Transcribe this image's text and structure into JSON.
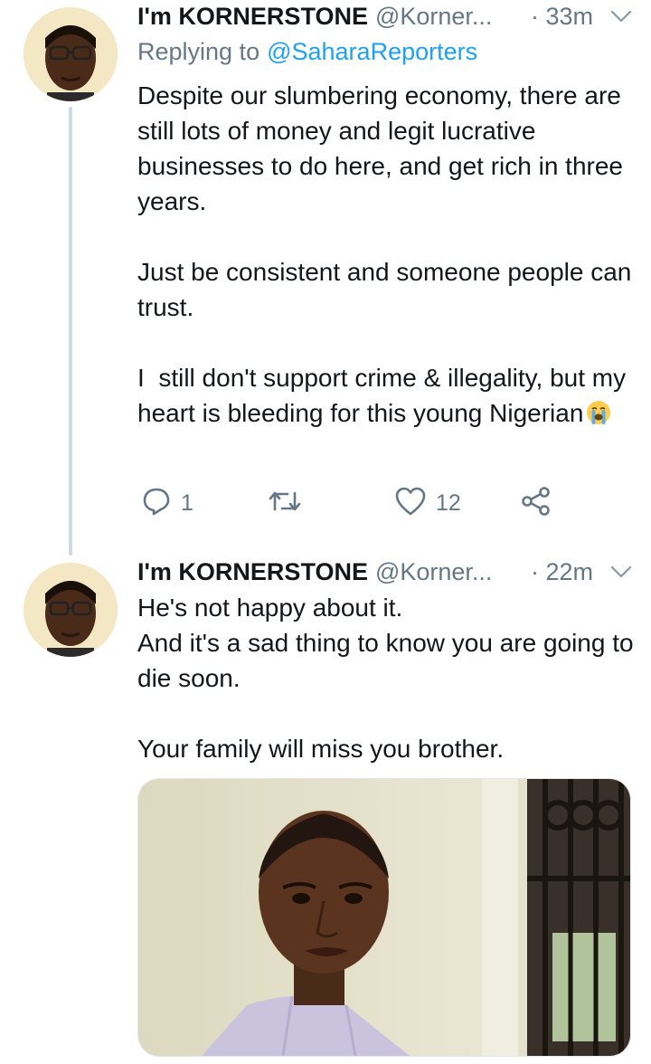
{
  "tweets": [
    {
      "display_name": "I'm KORNERSTONE",
      "handle": "@Korner...",
      "time": "· 33m",
      "replying_to_label": "Replying to",
      "replying_to_handle": "@SaharaReporters",
      "text": "Despite our slumbering economy, there are still lots of money and legit lucrative businesses to do here, and get rich in three years.\n\nJust be consistent and someone people can trust.\n\nI  still don't support crime & illegality, but my heart is bleeding for this young Nigerian",
      "emoji": "loudly-crying-face",
      "actions": {
        "reply_count": "1",
        "retweet_count": "",
        "like_count": "12"
      }
    },
    {
      "display_name": "I'm KORNERSTONE",
      "handle": "@Korner...",
      "time": "· 22m",
      "text": "He's not happy about it.\nAnd it's a sad thing to know you are going to die soon.\n\nYour family will miss you brother."
    }
  ],
  "colors": {
    "link": "#1da1f2",
    "secondary_text": "#657786",
    "thread_line": "#cfd9de"
  }
}
